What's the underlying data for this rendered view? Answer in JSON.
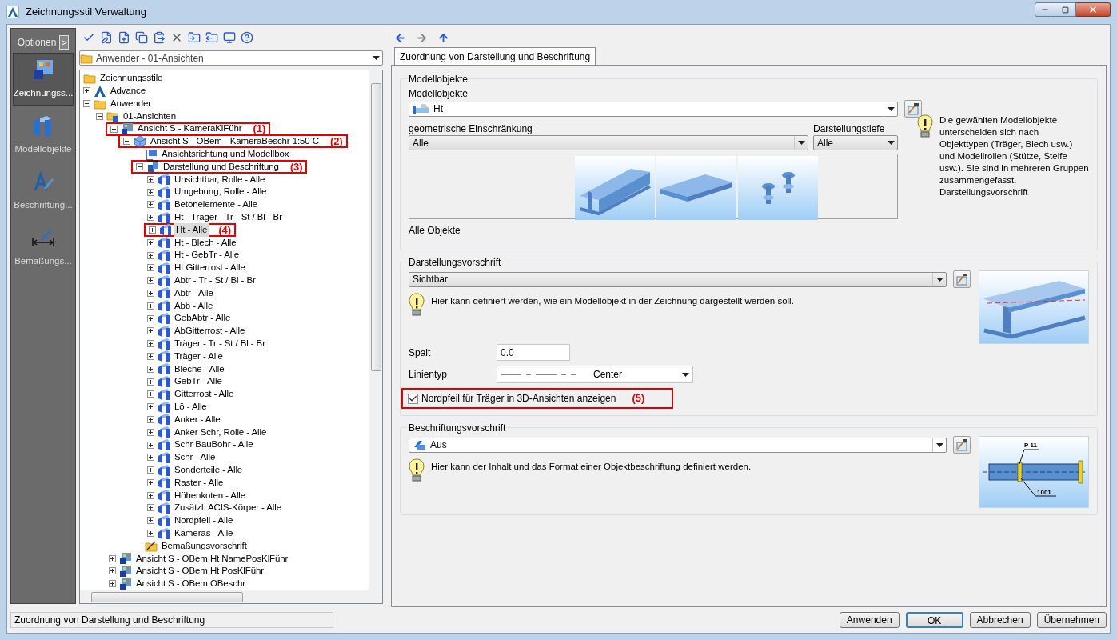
{
  "window": {
    "title": "Zeichnungsstil Verwaltung"
  },
  "sidebar": {
    "header": "Optionen",
    "expand_glyph": ">",
    "items": [
      {
        "label": "Zeichnungss...",
        "kind": "styles",
        "selected": true
      },
      {
        "label": "Modellobjekte",
        "kind": "objects",
        "selected": false
      },
      {
        "label": "Beschriftung...",
        "kind": "labels",
        "selected": false
      },
      {
        "label": "Bemaßungs...",
        "kind": "dimensions",
        "selected": false
      }
    ]
  },
  "tree_panel": {
    "path_select": {
      "value": "Anwender - 01-Ansichten"
    },
    "tree": [
      {
        "label": "Zeichnungsstile",
        "kind": "folder",
        "selected": false,
        "children": [
          {
            "label": "Advance",
            "kind": "advance",
            "expanded": false,
            "selected": false
          },
          {
            "label": "Anwender",
            "kind": "folder",
            "expanded": true,
            "selected": false,
            "children": [
              {
                "label": "01-Ansichten",
                "kind": "style-folder",
                "expanded": true,
                "selected": false,
                "children": [
                  {
                    "label": "Ansicht S - KameraKlFühr",
                    "kind": "view",
                    "expanded": true,
                    "selected": false,
                    "callout": "(1)",
                    "children": [
                      {
                        "label": "Ansicht S - OBem - KameraBeschr 1:50 C",
                        "kind": "model-view",
                        "expanded": true,
                        "selected": false,
                        "callout": "(2)",
                        "children": [
                          {
                            "label": "Ansichtsrichtung und Modellbox",
                            "kind": "direction",
                            "selected": false
                          },
                          {
                            "label": "Darstellung und Beschriftung",
                            "kind": "display",
                            "expanded": true,
                            "selected": false,
                            "callout": "(3)",
                            "children": [
                              {
                                "label": "Unsichtbar, Rolle - Alle",
                                "kind": "rule",
                                "expanded": false,
                                "selected": false
                              },
                              {
                                "label": "Umgebung, Rolle - Alle",
                                "kind": "rule",
                                "expanded": false,
                                "selected": false
                              },
                              {
                                "label": "Betonelemente - Alle",
                                "kind": "rule",
                                "expanded": false,
                                "selected": false
                              },
                              {
                                "label": "Ht - Träger - Tr - St / Bl - Br",
                                "kind": "rule",
                                "expanded": false,
                                "selected": false
                              },
                              {
                                "label": "Ht - Alle",
                                "kind": "rule",
                                "expanded": false,
                                "selected": true,
                                "callout": "(4)"
                              },
                              {
                                "label": "Ht - Blech - Alle",
                                "kind": "rule",
                                "expanded": false,
                                "selected": false
                              },
                              {
                                "label": "Ht - GebTr - Alle",
                                "kind": "rule",
                                "expanded": false,
                                "selected": false
                              },
                              {
                                "label": "Ht Gitterrost - Alle",
                                "kind": "rule",
                                "expanded": false,
                                "selected": false
                              },
                              {
                                "label": "Abtr - Tr - St / Bl - Br",
                                "kind": "rule",
                                "expanded": false,
                                "selected": false
                              },
                              {
                                "label": "Abtr - Alle",
                                "kind": "rule",
                                "expanded": false,
                                "selected": false
                              },
                              {
                                "label": "Abb - Alle",
                                "kind": "rule",
                                "expanded": false,
                                "selected": false
                              },
                              {
                                "label": "GebAbtr - Alle",
                                "kind": "rule",
                                "expanded": false,
                                "selected": false
                              },
                              {
                                "label": "AbGitterrost - Alle",
                                "kind": "rule",
                                "expanded": false,
                                "selected": false
                              },
                              {
                                "label": "Träger - Tr - St / Bl - Br",
                                "kind": "rule",
                                "expanded": false,
                                "selected": false
                              },
                              {
                                "label": "Träger - Alle",
                                "kind": "rule",
                                "expanded": false,
                                "selected": false
                              },
                              {
                                "label": "Bleche - Alle",
                                "kind": "rule",
                                "expanded": false,
                                "selected": false
                              },
                              {
                                "label": "GebTr - Alle",
                                "kind": "rule",
                                "expanded": false,
                                "selected": false
                              },
                              {
                                "label": "Gitterrost - Alle",
                                "kind": "rule",
                                "expanded": false,
                                "selected": false
                              },
                              {
                                "label": "Lö - Alle",
                                "kind": "rule",
                                "expanded": false,
                                "selected": false
                              },
                              {
                                "label": "Anker - Alle",
                                "kind": "rule",
                                "expanded": false,
                                "selected": false
                              },
                              {
                                "label": "Anker Schr, Rolle - Alle",
                                "kind": "rule",
                                "expanded": false,
                                "selected": false
                              },
                              {
                                "label": "Schr BauBohr - Alle",
                                "kind": "rule",
                                "expanded": false,
                                "selected": false
                              },
                              {
                                "label": "Schr - Alle",
                                "kind": "rule",
                                "expanded": false,
                                "selected": false
                              },
                              {
                                "label": "Sonderteile - Alle",
                                "kind": "rule",
                                "expanded": false,
                                "selected": false
                              },
                              {
                                "label": "Raster - Alle",
                                "kind": "rule",
                                "expanded": false,
                                "selected": false
                              },
                              {
                                "label": "Höhenkoten - Alle",
                                "kind": "rule",
                                "expanded": false,
                                "selected": false
                              },
                              {
                                "label": "Zusätzl. ACIS-Körper - Alle",
                                "kind": "rule",
                                "expanded": false,
                                "selected": false
                              },
                              {
                                "label": "Nordpfeil - Alle",
                                "kind": "rule",
                                "expanded": false,
                                "selected": false
                              },
                              {
                                "label": "Kameras - Alle",
                                "kind": "rule",
                                "expanded": false,
                                "selected": false
                              }
                            ]
                          },
                          {
                            "label": "Bemaßungsvorschrift",
                            "kind": "dim-folder",
                            "selected": false
                          }
                        ]
                      }
                    ]
                  },
                  {
                    "label": "Ansicht S - OBem Ht NamePosKlFühr",
                    "kind": "view",
                    "expanded": false,
                    "selected": false
                  },
                  {
                    "label": "Ansicht S - OBem Ht PosKlFühr",
                    "kind": "view",
                    "expanded": false,
                    "selected": false
                  },
                  {
                    "label": "Ansicht S - OBem OBeschr",
                    "kind": "view",
                    "expanded": false,
                    "selected": false
                  }
                ]
              }
            ]
          }
        ]
      }
    ]
  },
  "tabs": [
    {
      "label": "Zuordnung von Darstellung und Beschriftung",
      "selected": true
    }
  ],
  "model_objects": {
    "legend": "Modellobjekte",
    "label": "Modellobjekte",
    "value": "Ht",
    "geometry_label": "geometrische Einschränkung",
    "geometry_value": "Alle",
    "depth_label": "Darstellungstiefe",
    "depth_value": "Alle",
    "thumbnails": [
      {
        "kind": "beam"
      },
      {
        "kind": "plate"
      },
      {
        "kind": "bolts"
      }
    ],
    "caption": "Alle Objekte",
    "info": "Die gewählten Modellobjekte unterscheiden sich nach Objekttypen (Träger, Blech usw.) und Modellrollen (Stütze, Steife usw.). Sie sind in mehreren Gruppen zusammengefasst. Darstellungsvorschrift"
  },
  "display_rule": {
    "legend": "Darstellungsvorschrift",
    "value": "Sichtbar",
    "info": "Hier kann definiert werden, wie ein Modellobjekt in der Zeichnung dargestellt werden soll.",
    "gap_label": "Spalt",
    "gap_value": "0.0",
    "linetype_label": "Linientyp",
    "linetype_value": "Center",
    "north_arrow": {
      "label": "Nordpfeil für Träger in 3D-Ansichten anzeigen",
      "checked": true,
      "callout": "(5)"
    }
  },
  "label_rule": {
    "legend": "Beschriftungsvorschrift",
    "value": "Aus",
    "info": "Hier kann der Inhalt und das Format einer Objektbeschriftung definiert werden.",
    "preview_labels": [
      "P 11",
      "1001"
    ]
  },
  "status_bar": {
    "text": "Zuordnung von Darstellung und Beschriftung"
  },
  "buttons": [
    {
      "label": "Anwenden",
      "default": false
    },
    {
      "label": "OK",
      "default": true
    },
    {
      "label": "Abbrechen",
      "default": false
    },
    {
      "label": "Übernehmen",
      "default": false
    }
  ]
}
